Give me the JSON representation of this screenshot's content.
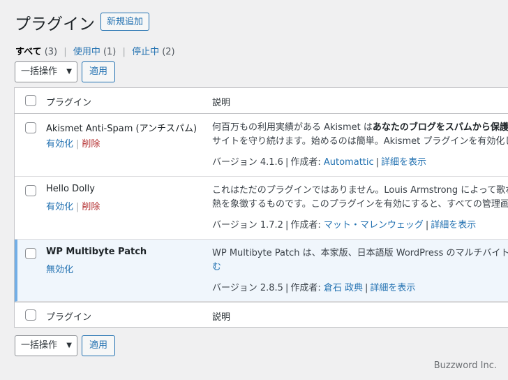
{
  "page": {
    "title": "プラグイン",
    "add_new": "新規追加"
  },
  "filters": [
    {
      "label": "すべて",
      "count": "(3)"
    },
    {
      "label": "使用中",
      "count": "(1)"
    },
    {
      "label": "停止中",
      "count": "(2)"
    }
  ],
  "bulk": {
    "select": "一括操作",
    "apply": "適用"
  },
  "table": {
    "headers": {
      "name": "プラグイン",
      "description": "説明"
    },
    "plugins": [
      {
        "name": "Akismet Anti-Spam (アンチスパム)",
        "actions": [
          "有効化",
          "削除"
        ],
        "desc_line1_pre": "何百万もの利用実績がある Akismet は",
        "desc_line1_bold": "あなたのブログをスパムから保護す",
        "desc_line2": "サイトを守り続けます。始めるのは簡単。Akismet プラグインを有効化し",
        "version": "バージョン 4.1.6",
        "author_label": "作成者:",
        "author": "Automattic",
        "details": "詳細を表示"
      },
      {
        "name": "Hello Dolly",
        "actions": [
          "有効化",
          "削除"
        ],
        "desc_line1": "これはただのプラグインではありません。Louis Armstrong によって歌わ",
        "desc_line2": "熱を象徴するものです。このプラグインを有効にすると、すべての管理画",
        "version": "バージョン 1.7.2",
        "author_label": "作成者:",
        "author": "マット・マレンウェッグ",
        "details": "詳細を表示"
      },
      {
        "name": "WP Multibyte Patch",
        "actions": [
          "無効化"
        ],
        "desc_line1": "WP Multibyte Patch は、本家版、日本語版 WordPress のマルチバイト文字",
        "desc_line2": "む",
        "version": "バージョン 2.8.5",
        "author_label": "作成者:",
        "author": "倉石 政典",
        "details": "詳細を表示"
      }
    ]
  },
  "watermark": "Buzzword Inc."
}
